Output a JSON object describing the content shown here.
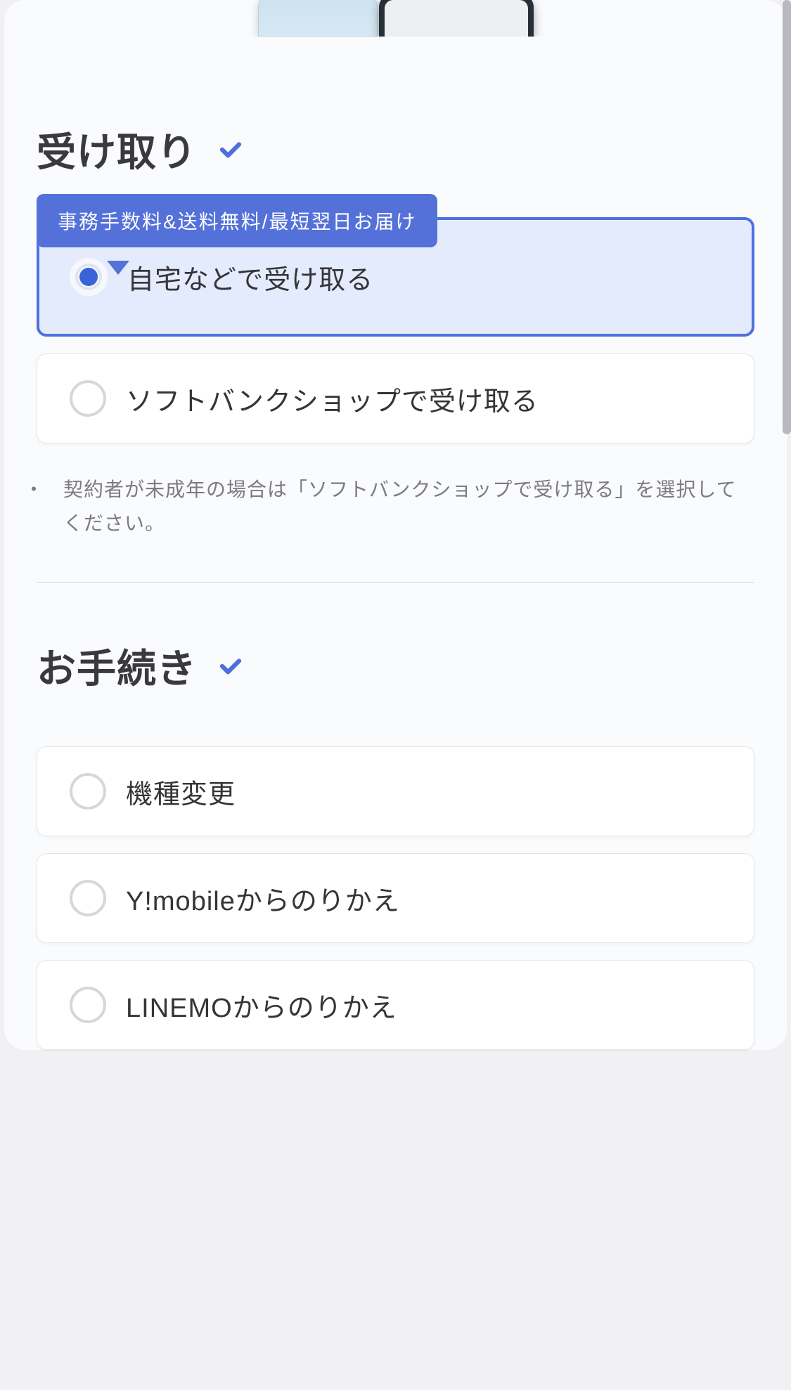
{
  "colors": {
    "accent": "#4f70dc",
    "accent_fill": "#e4ebfd",
    "badge_bg": "#5471d9"
  },
  "receive": {
    "title": "受け取り",
    "badge": "事務手数料&送料無料/最短翌日お届け",
    "options": {
      "home": {
        "label": "自宅などで受け取る",
        "selected": true
      },
      "shop": {
        "label": "ソフトバンクショップで受け取る",
        "selected": false
      }
    },
    "note_bullet": "・",
    "note": "契約者が未成年の場合は「ソフトバンクショップで受け取る」を選択してください。"
  },
  "procedure": {
    "title": "お手続き",
    "options": {
      "change": {
        "label": "機種変更",
        "selected": false
      },
      "ymobile": {
        "label": "Y!mobileからのりかえ",
        "selected": false
      },
      "linemo": {
        "label": "LINEMOからのりかえ",
        "selected": false
      }
    }
  }
}
